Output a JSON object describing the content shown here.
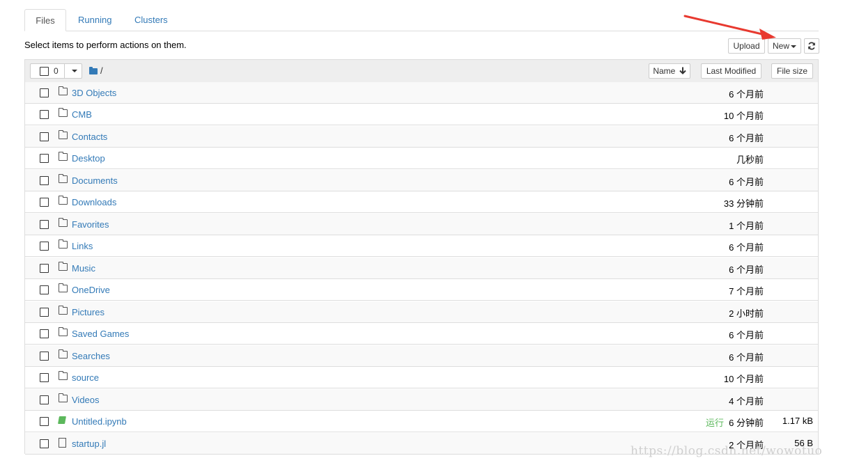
{
  "tabs": [
    {
      "label": "Files",
      "active": true
    },
    {
      "label": "Running",
      "active": false
    },
    {
      "label": "Clusters",
      "active": false
    }
  ],
  "hint": "Select items to perform actions on them.",
  "toolbar": {
    "upload_label": "Upload",
    "new_label": "New",
    "refresh_icon": "refresh-icon"
  },
  "list_header": {
    "selected_count": "0",
    "breadcrumb": "/",
    "sort_name_label": "Name",
    "sort_modified_label": "Last Modified",
    "sort_size_label": "File size"
  },
  "items": [
    {
      "name": "3D Objects",
      "type": "folder",
      "modified": "6 个月前",
      "status": "",
      "size": ""
    },
    {
      "name": "CMB",
      "type": "folder",
      "modified": "10 个月前",
      "status": "",
      "size": ""
    },
    {
      "name": "Contacts",
      "type": "folder",
      "modified": "6 个月前",
      "status": "",
      "size": ""
    },
    {
      "name": "Desktop",
      "type": "folder",
      "modified": "几秒前",
      "status": "",
      "size": ""
    },
    {
      "name": "Documents",
      "type": "folder",
      "modified": "6 个月前",
      "status": "",
      "size": ""
    },
    {
      "name": "Downloads",
      "type": "folder",
      "modified": "33 分钟前",
      "status": "",
      "size": ""
    },
    {
      "name": "Favorites",
      "type": "folder",
      "modified": "1 个月前",
      "status": "",
      "size": ""
    },
    {
      "name": "Links",
      "type": "folder",
      "modified": "6 个月前",
      "status": "",
      "size": ""
    },
    {
      "name": "Music",
      "type": "folder",
      "modified": "6 个月前",
      "status": "",
      "size": ""
    },
    {
      "name": "OneDrive",
      "type": "folder",
      "modified": "7 个月前",
      "status": "",
      "size": ""
    },
    {
      "name": "Pictures",
      "type": "folder",
      "modified": "2 小时前",
      "status": "",
      "size": ""
    },
    {
      "name": "Saved Games",
      "type": "folder",
      "modified": "6 个月前",
      "status": "",
      "size": ""
    },
    {
      "name": "Searches",
      "type": "folder",
      "modified": "6 个月前",
      "status": "",
      "size": ""
    },
    {
      "name": "source",
      "type": "folder",
      "modified": "10 个月前",
      "status": "",
      "size": ""
    },
    {
      "name": "Videos",
      "type": "folder",
      "modified": "4 个月前",
      "status": "",
      "size": ""
    },
    {
      "name": "Untitled.ipynb",
      "type": "notebook",
      "modified": "6 分钟前",
      "status": "运行",
      "size": "1.17 kB"
    },
    {
      "name": "startup.jl",
      "type": "file",
      "modified": "2 个月前",
      "status": "",
      "size": "56 B"
    }
  ],
  "watermark": "https://blog.csdn.net/wowotuo",
  "colors": {
    "link": "#337ab7",
    "running": "#5cb85c",
    "annotation_arrow": "#e8392f"
  }
}
